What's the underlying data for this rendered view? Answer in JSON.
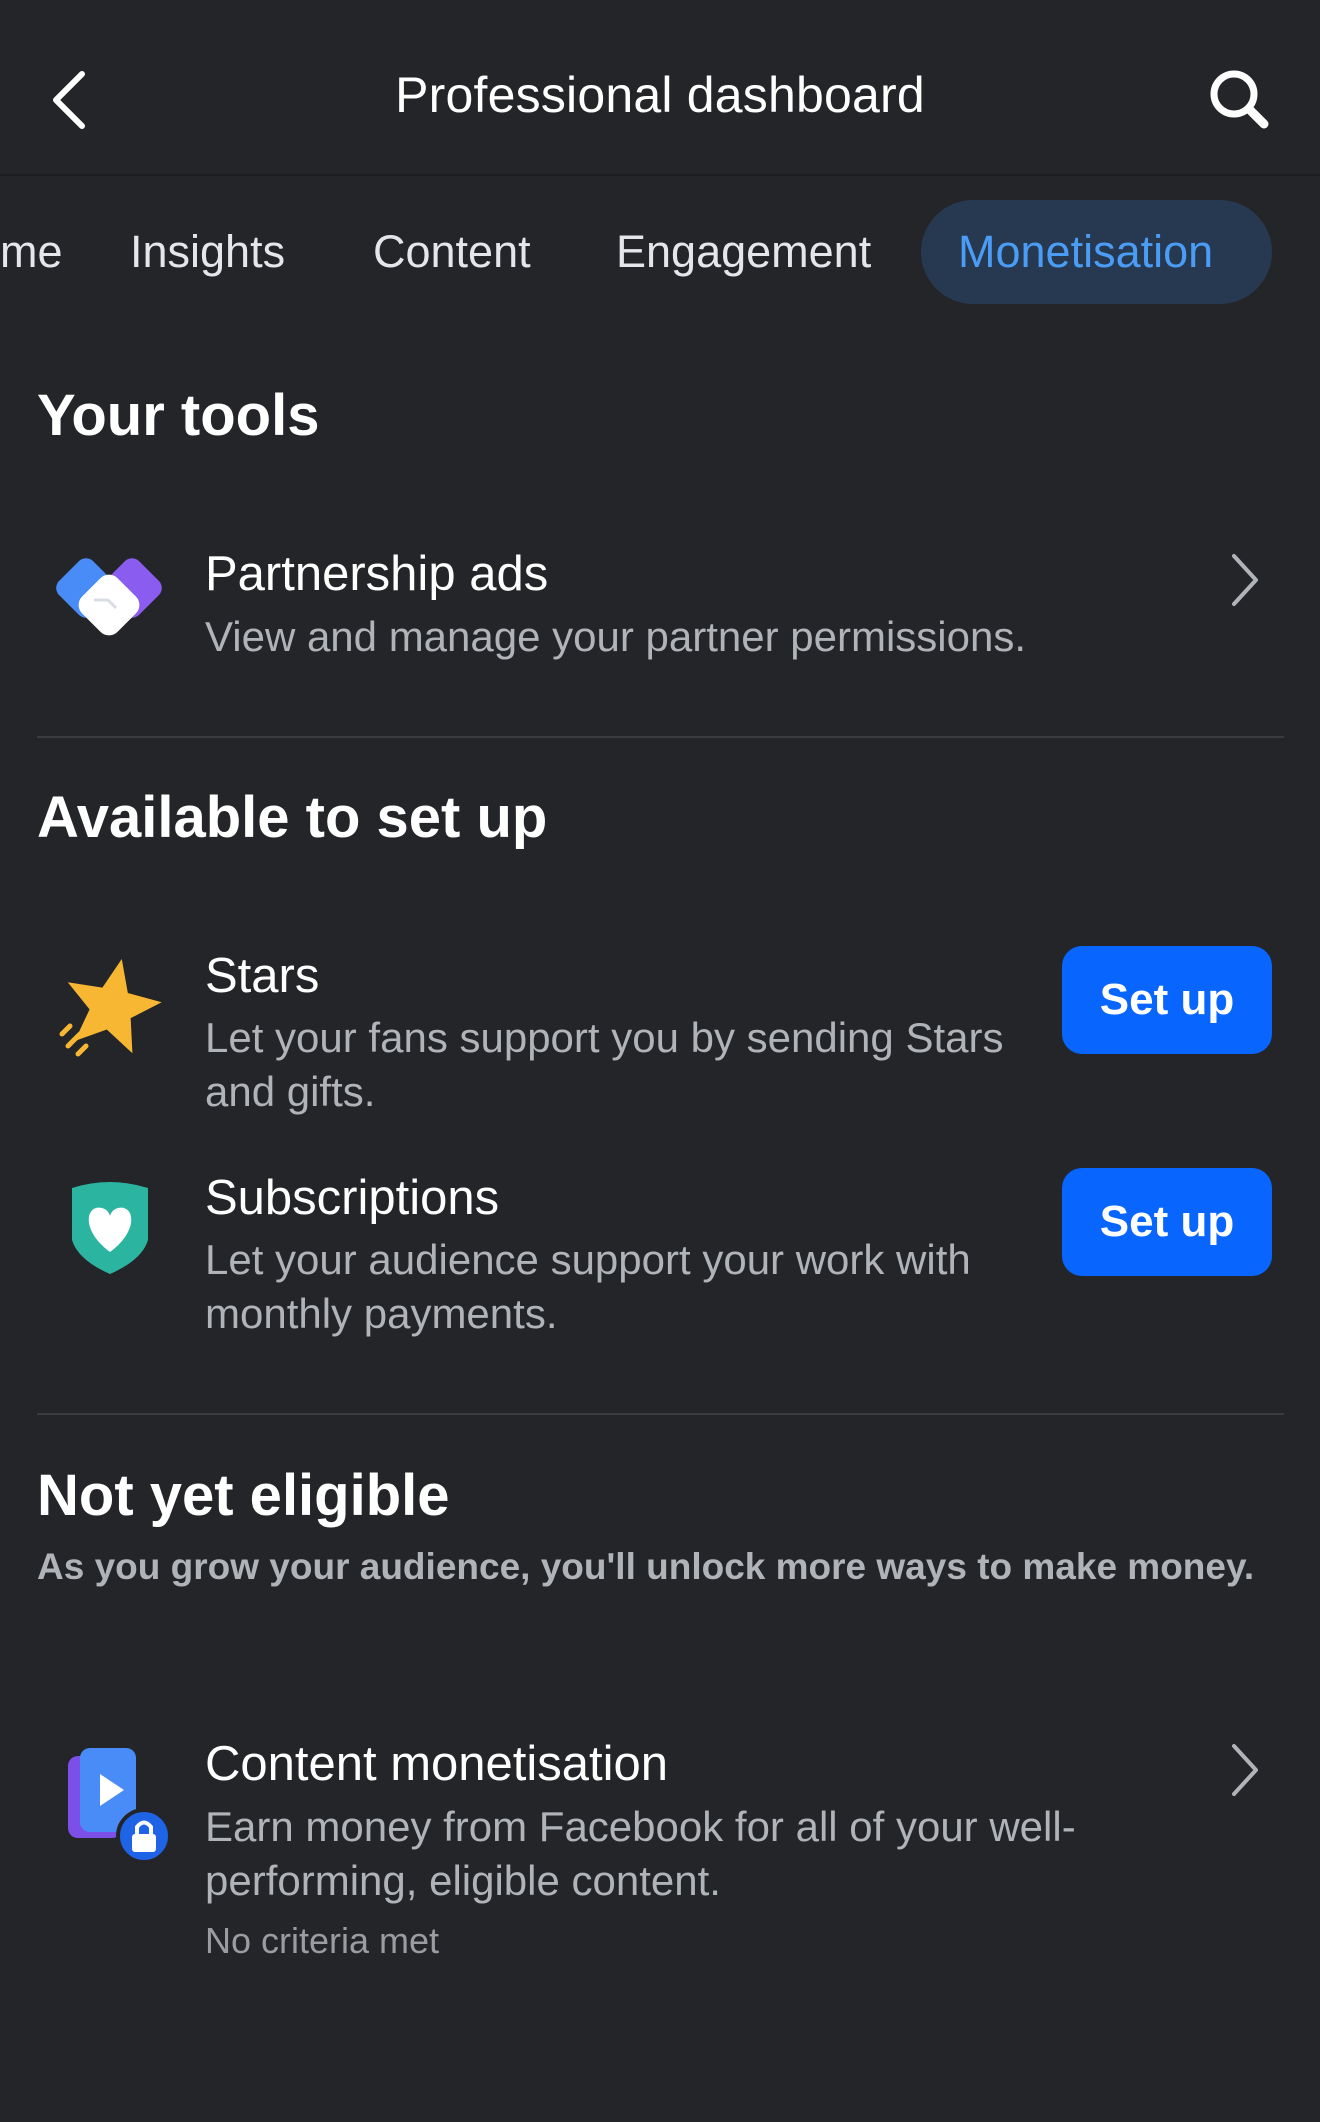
{
  "header": {
    "title": "Professional dashboard",
    "back_icon": "chevron-left-icon",
    "search_icon": "search-icon"
  },
  "tabs": [
    {
      "label": "me",
      "active": false
    },
    {
      "label": "Insights",
      "active": false
    },
    {
      "label": "Content",
      "active": false
    },
    {
      "label": "Engagement",
      "active": false
    },
    {
      "label": "Monetisation",
      "active": true
    }
  ],
  "your_tools": {
    "title": "Your tools",
    "items": [
      {
        "icon": "handshake-icon",
        "title": "Partnership ads",
        "description": "View and manage your partner permissions."
      }
    ]
  },
  "available": {
    "title": "Available to set up",
    "items": [
      {
        "icon": "star-icon",
        "title": "Stars",
        "description": "Let your fans support you by sending Stars and gifts.",
        "button": "Set up"
      },
      {
        "icon": "heart-shield-icon",
        "title": "Subscriptions",
        "description": "Let your audience support your work with monthly payments.",
        "button": "Set up"
      }
    ]
  },
  "not_eligible": {
    "title": "Not yet eligible",
    "note": "As you grow your audience, you'll unlock more ways to make money.",
    "items": [
      {
        "icon": "video-lock-icon",
        "title": "Content monetisation",
        "description": "Earn money from Facebook for all of your well-performing, eligible content.",
        "status": "No criteria met"
      }
    ]
  },
  "colors": {
    "background": "#242528",
    "accent": "#0866ff",
    "active_tab_bg": "#263951",
    "active_tab_text": "#4a9cf5"
  }
}
